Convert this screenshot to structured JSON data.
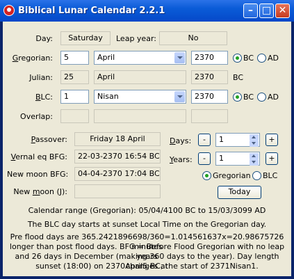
{
  "window": {
    "title": "Biblical Lunar Calendar 2.2.1"
  },
  "row_day": {
    "label": "Day:",
    "value": "Saturday",
    "leap_label": "Leap year:",
    "leap_value": "No"
  },
  "gregorian": {
    "label": "Gregorian:",
    "day": "5",
    "month": "April",
    "year": "2370",
    "bc": "BC",
    "ad": "AD"
  },
  "julian": {
    "label": "Julian:",
    "day": "25",
    "month": "April",
    "year": "2370",
    "era": "BC"
  },
  "blc": {
    "label": "BLC:",
    "day": "1",
    "month": "Nisan",
    "year": "2370",
    "bc": "BC",
    "ad": "AD"
  },
  "overlap": {
    "label": "Overlap:"
  },
  "passover": {
    "label": "Passover:",
    "value": "Friday 18 April"
  },
  "vernal": {
    "label": "Vernal eq BFG:",
    "value": "22-03-2370 16:54 BC"
  },
  "newmoon_bfg": {
    "label": "New moon BFG:",
    "value": "04-04-2370 17:04 BC"
  },
  "newmoon_j": {
    "label": "New moon (J):",
    "value": ""
  },
  "days": {
    "label": "Days:",
    "minus": "-",
    "plus": "+",
    "value": "1"
  },
  "years": {
    "label": "Years:",
    "minus": "-",
    "plus": "+",
    "value": "1"
  },
  "mode": {
    "gregorian": "Gregorian",
    "blc": "BLC"
  },
  "today_button": "Today",
  "info": {
    "range": "Calendar range (Gregorian): 05/04/4100 BC to 15/03/3099 AD",
    "sunset": "The BLC day starts at sunset Local Time on the Gregorian day.",
    "note_lines": [
      "Pre flood days are 365.2421896698/360=1.014561637x=20.98675726 minutes",
      "longer than post flood days. BFG = Before Flood Gregorian with no leap years",
      "and 26 days in December (making 360 days to the year). Day length changes at",
      "sunset (18:00) on 2370April5 BC, the start of 2371Nisan1."
    ]
  }
}
